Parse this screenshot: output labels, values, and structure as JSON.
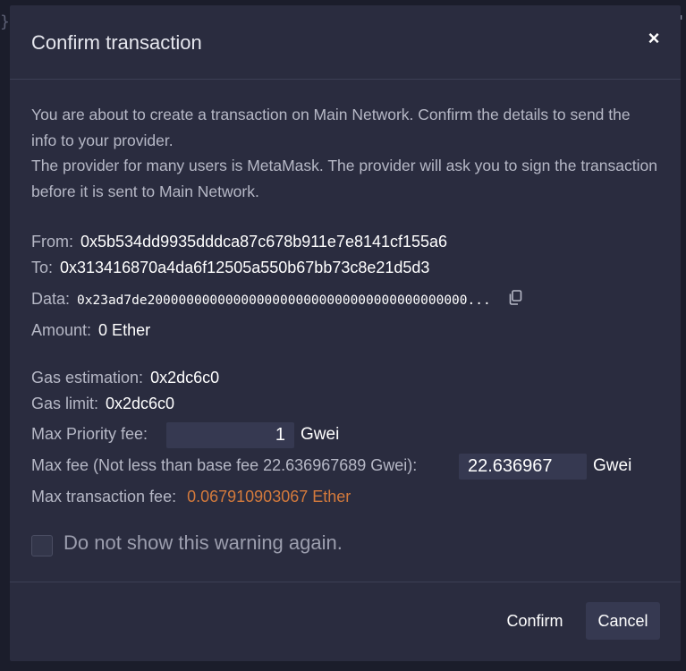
{
  "background": {
    "left_glyph": "}",
    "right_glyph": "'"
  },
  "dialog": {
    "title": "Confirm transaction",
    "close_label": "×",
    "intro": [
      "You are about to create a transaction on Main Network. Confirm the details to send the info to your provider.",
      "The provider for many users is MetaMask. The provider will ask you to sign the transaction before it is sent to Main Network."
    ],
    "from_label": "From:",
    "from_value": "0x5b534dd9935dddca87c678b911e7e8141cf155a6",
    "to_label": "To:",
    "to_value": "0x313416870a4da6f12505a550b67bb73c8e21d5d3",
    "data_label": "Data:",
    "data_value": "0x23ad7de20000000000000000000000000000000000000000...",
    "amount_label": "Amount:",
    "amount_value": "0 Ether",
    "gas_estimation_label": "Gas estimation:",
    "gas_estimation_value": "0x2dc6c0",
    "gas_limit_label": "Gas limit:",
    "gas_limit_value": "0x2dc6c0",
    "max_priority_label": "Max Priority fee:",
    "max_priority_value": "1",
    "max_priority_unit": "Gwei",
    "max_fee_label": "Max fee (Not less than base fee 22.636967689 Gwei):",
    "max_fee_value": "22.636967",
    "max_fee_unit": "Gwei",
    "max_tx_fee_label": "Max transaction fee:",
    "max_tx_fee_value": "0.067910903067 Ether",
    "checkbox_label": "Do not show this warning again.",
    "confirm_label": "Confirm",
    "cancel_label": "Cancel"
  },
  "colors": {
    "modal_bg": "#2a2c3f",
    "fee_accent": "#d47a3c",
    "input_bg": "#363951"
  }
}
